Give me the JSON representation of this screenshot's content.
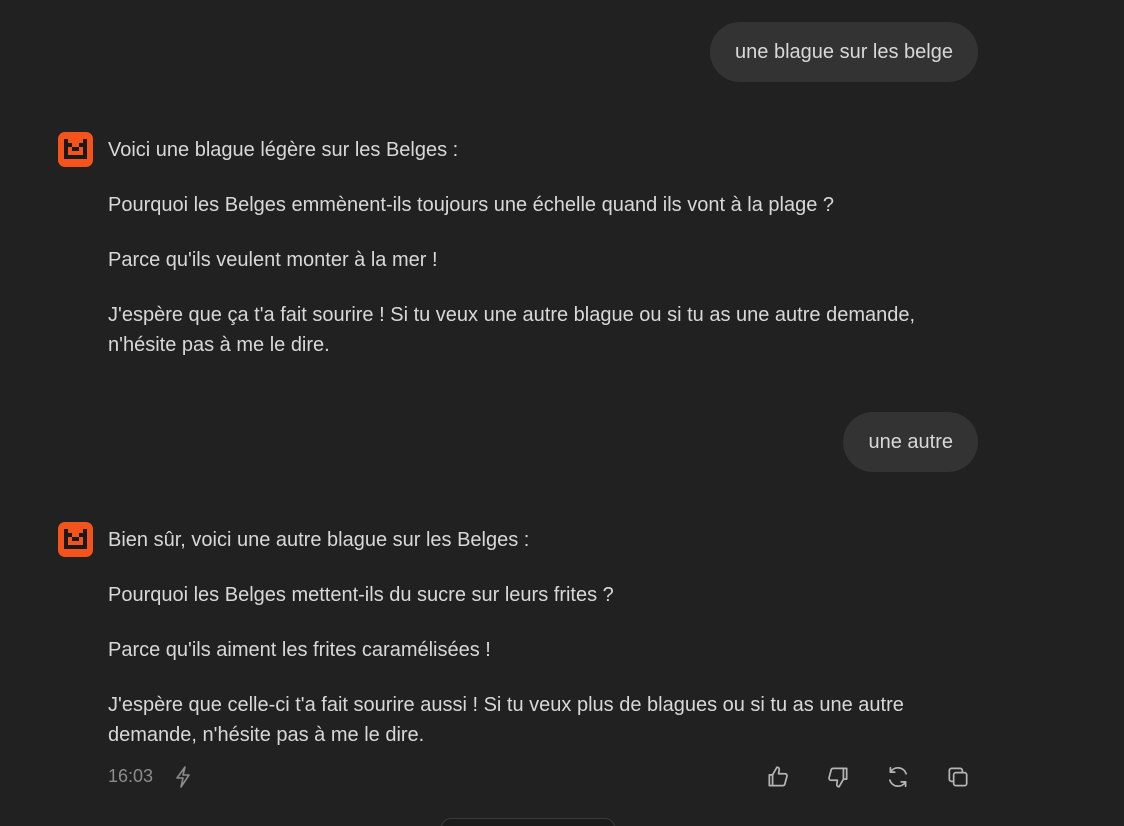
{
  "conversation": {
    "user_messages": [
      {
        "text": "une blague sur les belge"
      },
      {
        "text": "une autre"
      }
    ],
    "assistant_messages": [
      {
        "paragraphs": [
          "Voici une blague légère sur les Belges :",
          "Pourquoi les Belges emmènent-ils toujours une échelle quand ils vont à la plage ?",
          "Parce qu'ils veulent monter à la mer !",
          "J'espère que ça t'a fait sourire ! Si tu veux une autre blague ou si tu as une autre demande, n'hésite pas à me le dire."
        ]
      },
      {
        "paragraphs": [
          "Bien sûr, voici une autre blague sur les Belges :",
          "Pourquoi les Belges mettent-ils du sucre sur leurs frites ?",
          "Parce qu'ils aiment les frites caramélisées !",
          "J'espère que celle-ci t'a fait sourire aussi ! Si tu veux plus de blagues ou si tu as une autre demande, n'hésite pas à me le dire."
        ],
        "timestamp": "16:03"
      }
    ]
  },
  "icons": {
    "avatar": "mistral-logo-icon",
    "speed": "lightning-bolt-icon",
    "like": "thumbs-up-icon",
    "dislike": "thumbs-down-icon",
    "regenerate": "refresh-icon",
    "copy": "copy-icon"
  },
  "colors": {
    "background": "#212121",
    "user_bubble": "#333333",
    "text": "#d8d8d8",
    "muted": "#8c8c8c",
    "brand": "#f4541c"
  }
}
